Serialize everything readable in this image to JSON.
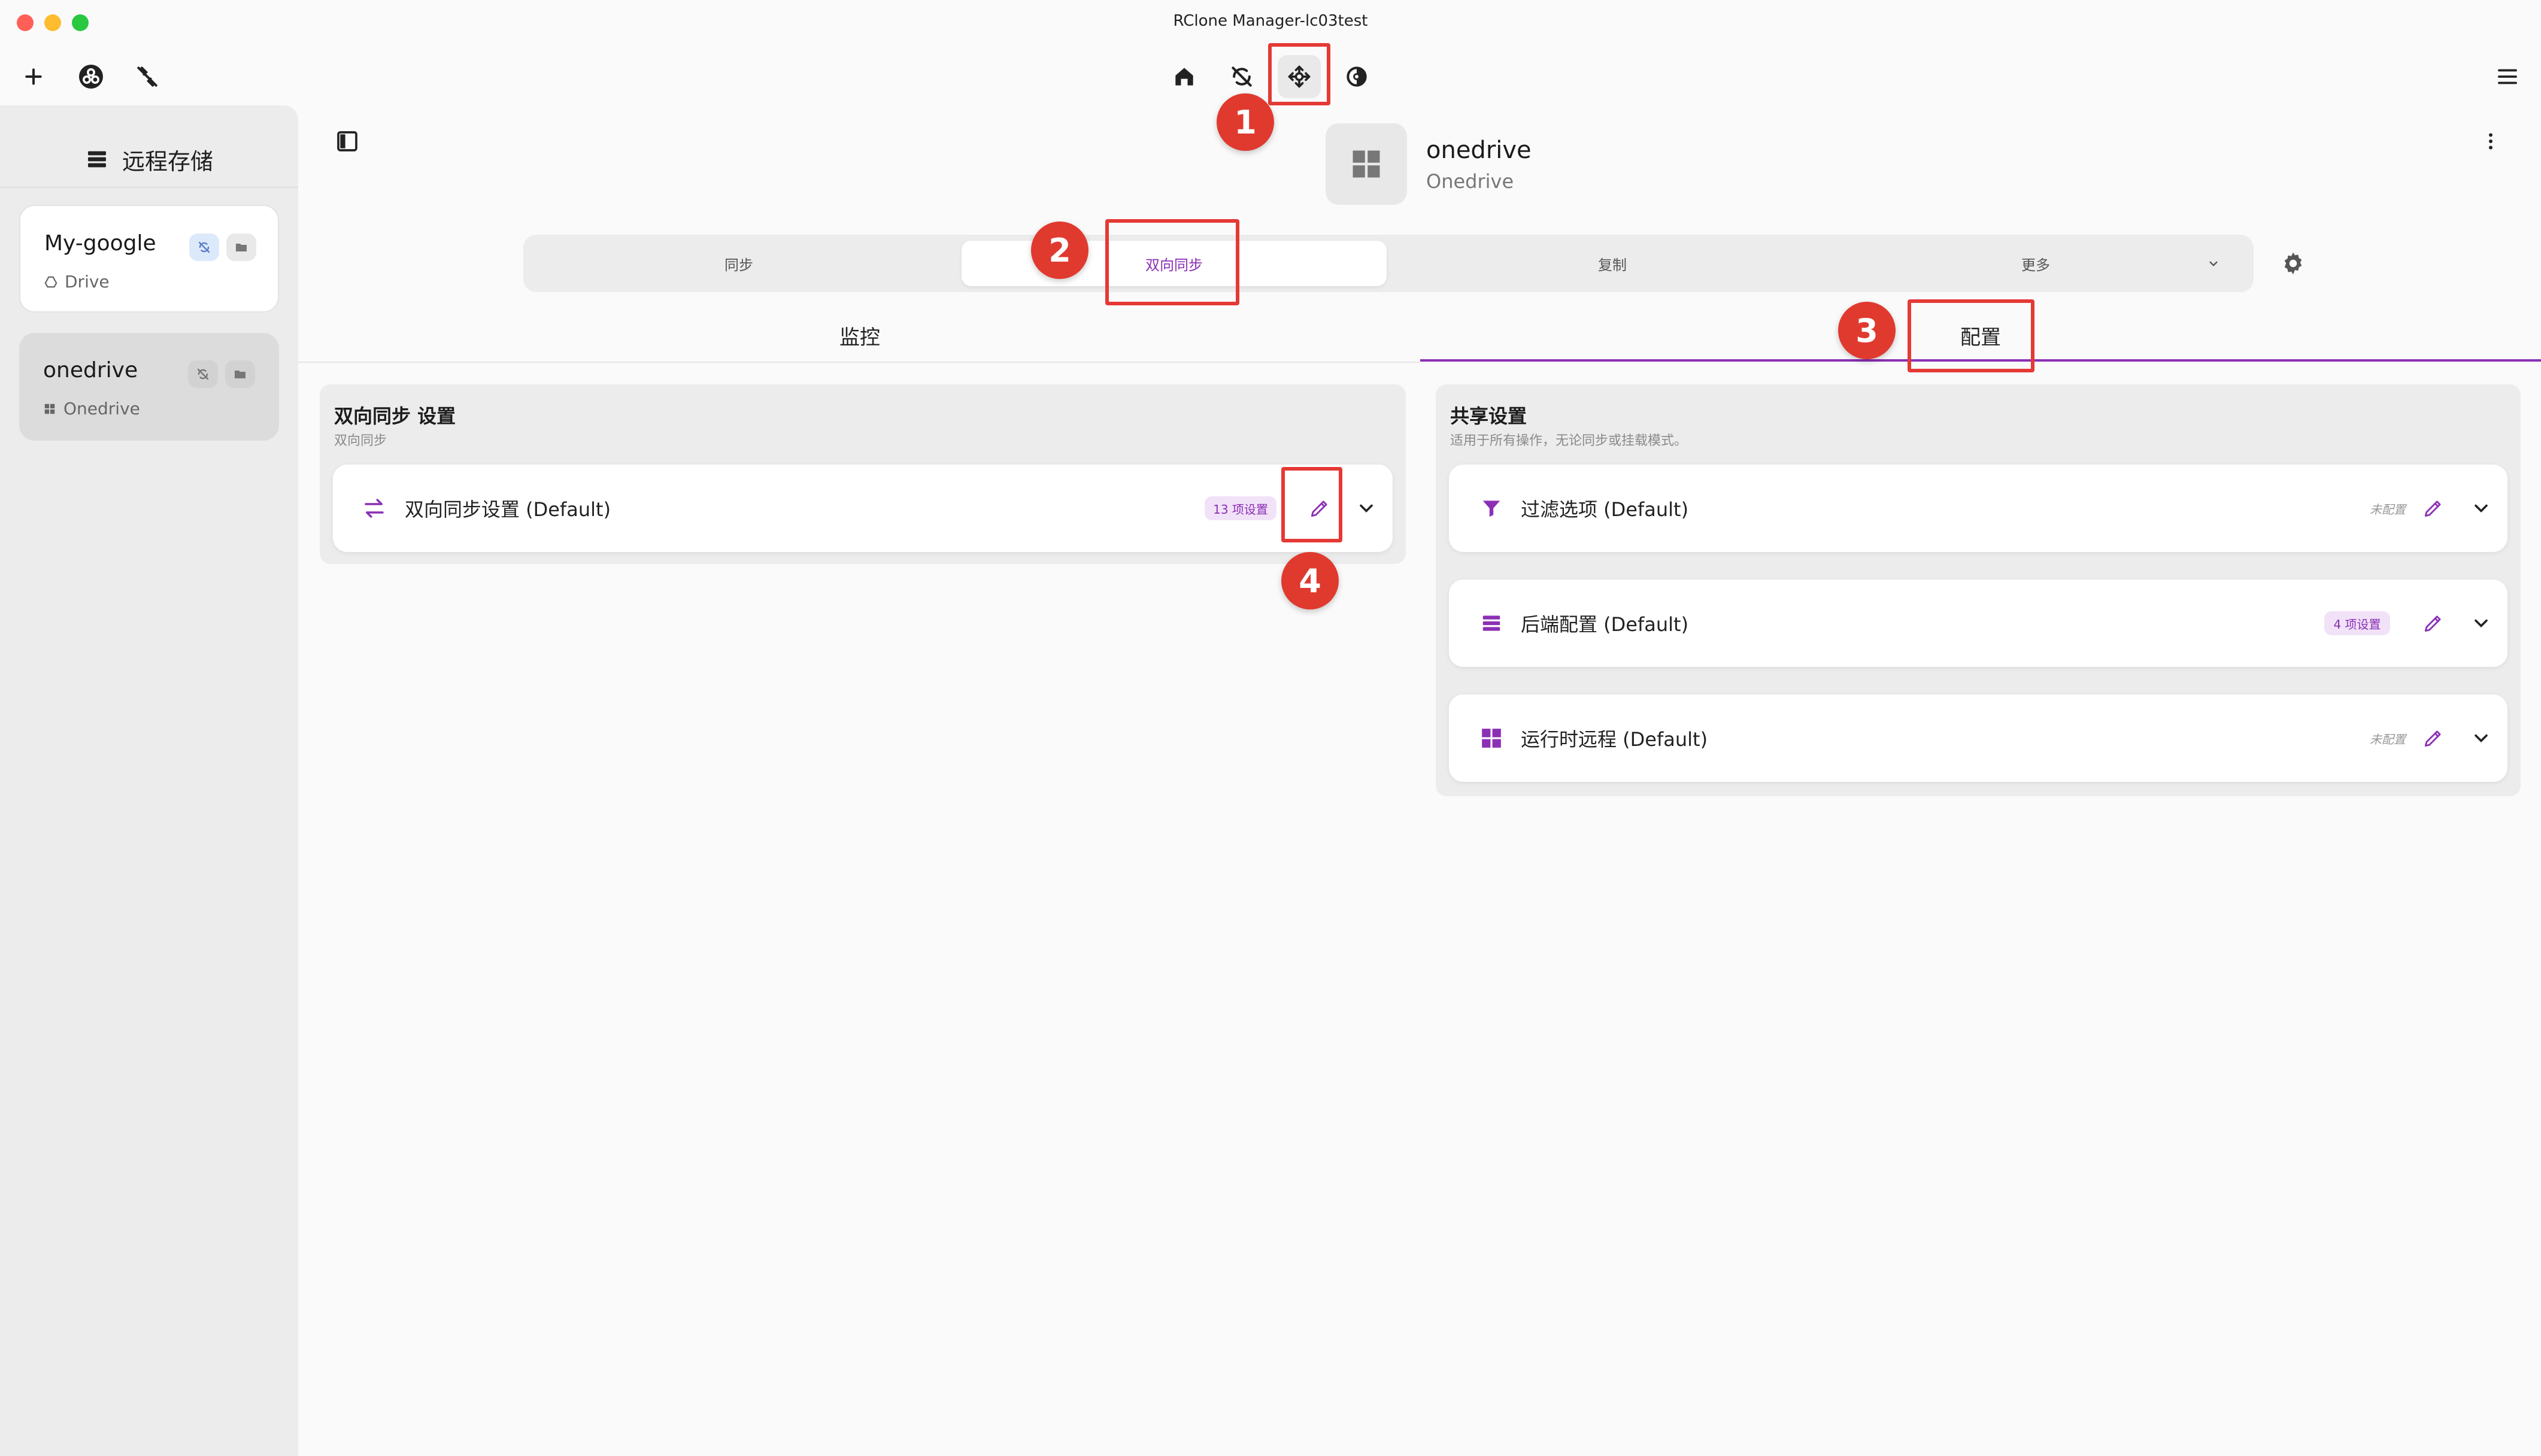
{
  "window": {
    "title": "RClone Manager-lc03test",
    "traffic_colors": [
      "#ff5f57",
      "#febc2e",
      "#28c840"
    ]
  },
  "toolbar": {
    "left_icons": [
      "plus-icon",
      "rclone-logo-icon",
      "no-network-icon"
    ],
    "nav_icons": [
      "home-icon",
      "sync-icon",
      "mount-icon",
      "serve-icon"
    ],
    "active_nav": "mount-icon",
    "menu_icon": "hamburger-icon"
  },
  "sidebar": {
    "title": "远程存储",
    "remotes": [
      {
        "name": "My-google",
        "type": "Drive",
        "icon": "drive-icon"
      },
      {
        "name": "onedrive",
        "type": "Onedrive",
        "icon": "windows-icon"
      }
    ]
  },
  "remote_header": {
    "name": "onedrive",
    "type": "Onedrive"
  },
  "segmented": {
    "tabs": [
      "同步",
      "双向同步",
      "复制",
      "更多"
    ],
    "active_index": 1
  },
  "subtabs": {
    "items": [
      "监控",
      "配置"
    ],
    "active_index": 1
  },
  "bisync_panel": {
    "title": "双向同步 设置",
    "subtitle": "双向同步",
    "row": {
      "label": "双向同步设置 (Default)",
      "chip": "13 项设置"
    }
  },
  "shared_panel": {
    "title": "共享设置",
    "subtitle": "适用于所有操作，无论同步或挂载模式。",
    "rows": [
      {
        "label": "过滤选项 (Default)",
        "status": "未配置",
        "icon": "filter-icon"
      },
      {
        "label": "后端配置 (Default)",
        "chip": "4 项设置",
        "icon": "list-icon"
      },
      {
        "label": "运行时远程 (Default)",
        "status": "未配置",
        "icon": "grid-icon"
      }
    ]
  },
  "annotations": [
    "1",
    "2",
    "3",
    "4"
  ],
  "colors": {
    "accent": "#8b2fb5",
    "annotation_red": "#e53935"
  }
}
